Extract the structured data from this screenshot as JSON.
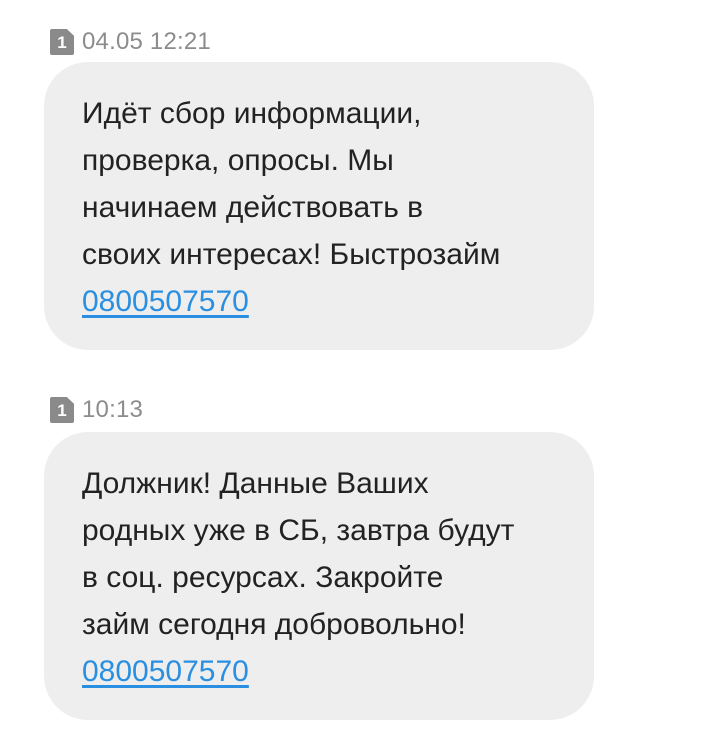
{
  "messages": [
    {
      "sim_slot": "1",
      "timestamp": "04.05 12:21",
      "text": "Идёт сбор информации,\nпроверка, опросы. Мы\nначинаем действовать в\nсвоих интересах! Быстрозайм",
      "link": "0800507570"
    },
    {
      "sim_slot": "1",
      "timestamp": "10:13",
      "text": "Должник! Данные Ваших\nродных уже в СБ, завтра будут\nв соц. ресурсах. Закройте\nзайм сегодня добровольно!",
      "link": "0800507570"
    }
  ],
  "colors": {
    "bubble_background": "#eeeeee",
    "link": "#2a8fe0",
    "timestamp": "#8c8c8c",
    "sim_icon": "#8a8a8a"
  },
  "icons": {
    "sim": "sim-card-icon"
  }
}
